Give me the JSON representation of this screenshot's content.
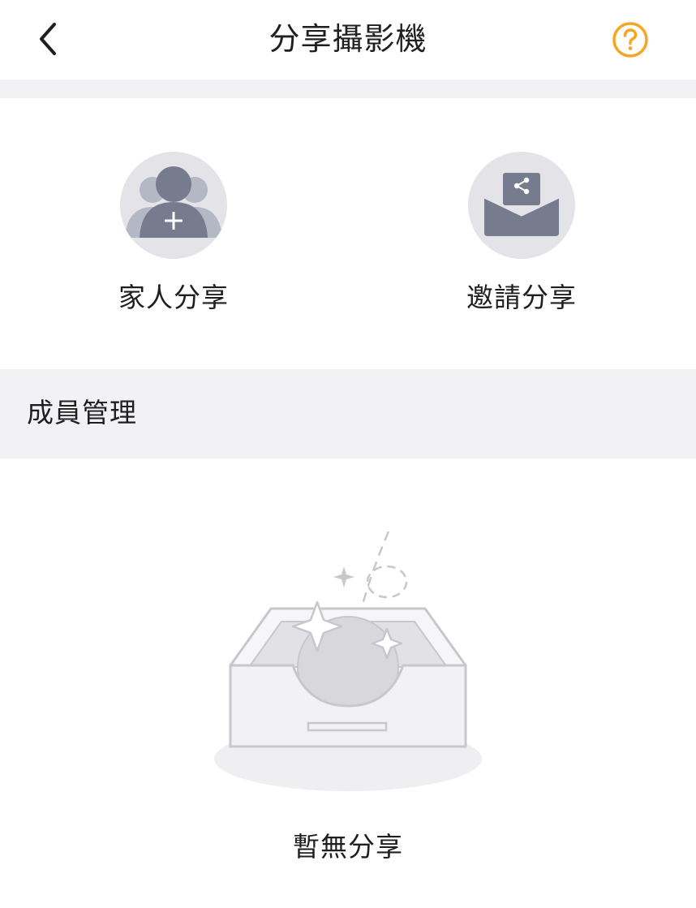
{
  "header": {
    "title": "分享攝影機",
    "back_icon": "chevron-left-icon",
    "help_icon": "question-circle-icon",
    "help_color": "#f5a623"
  },
  "share_options": [
    {
      "label": "家人分享",
      "icon": "add-family-member-icon"
    },
    {
      "label": "邀請分享",
      "icon": "share-invitation-envelope-icon"
    }
  ],
  "members": {
    "section_title": "成員管理",
    "empty_text": "暫無分享",
    "empty_icon": "empty-inbox-icon"
  },
  "colors": {
    "accent": "#f5a623",
    "icon_fill": "#767b8e",
    "icon_bg": "#e4e4e8",
    "section_bg": "#f2f2f4"
  }
}
